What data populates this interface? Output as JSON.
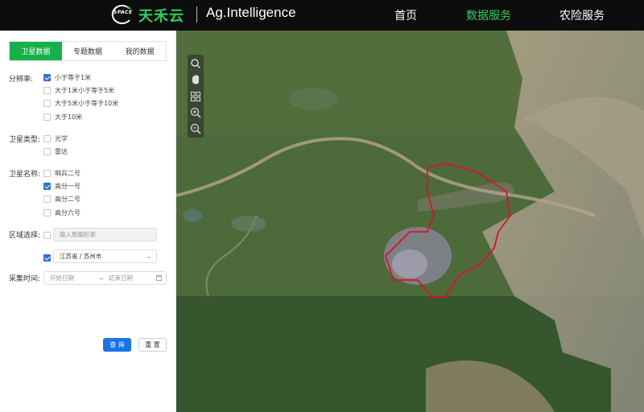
{
  "header": {
    "logo_text": "SPACE",
    "brand_cn": "天禾云",
    "brand_en": "Ag.Intelligence",
    "nav": [
      {
        "label": "首页",
        "active": false
      },
      {
        "label": "数据服务",
        "active": true
      },
      {
        "label": "农险服务",
        "active": false
      }
    ],
    "accent_color": "#2bd15a"
  },
  "sidebar": {
    "tabs": [
      {
        "label": "卫星数据",
        "active": true
      },
      {
        "label": "专题数据",
        "active": false
      },
      {
        "label": "我的数据",
        "active": false
      }
    ],
    "resolution": {
      "label": "分辨率:",
      "options": [
        {
          "label": "小于等于1米",
          "checked": true
        },
        {
          "label": "大于1米小于等于5米",
          "checked": false
        },
        {
          "label": "大于5米小于等于10米",
          "checked": false
        },
        {
          "label": "大于10米",
          "checked": false
        }
      ]
    },
    "satellite_type": {
      "label": "卫星类型:",
      "options": [
        {
          "label": "光学",
          "checked": false
        },
        {
          "label": "雷达",
          "checked": false
        }
      ]
    },
    "satellite_name": {
      "label": "卫星名称:",
      "options": [
        {
          "label": "哨兵二号",
          "checked": false
        },
        {
          "label": "高分一号",
          "checked": true
        },
        {
          "label": "高分二号",
          "checked": false
        },
        {
          "label": "高分六号",
          "checked": false
        }
      ]
    },
    "region": {
      "label": "区域选择:",
      "search_placeholder": "输入数据检索",
      "search_checked": false,
      "select_checked": true,
      "selected_region": "江苏省 / 苏州市"
    },
    "time": {
      "label": "采集时间:",
      "start_placeholder": "开始日期",
      "end_placeholder": "结束日期",
      "separator": "→"
    },
    "query_button": "查 询",
    "reset_button": "重 置",
    "primary_color": "#1a73e8"
  },
  "map": {
    "tools": [
      "search-icon",
      "pan-hand-icon",
      "grid-layers-icon",
      "zoom-in-icon",
      "zoom-out-icon"
    ],
    "boundary_color": "#e0102a"
  }
}
